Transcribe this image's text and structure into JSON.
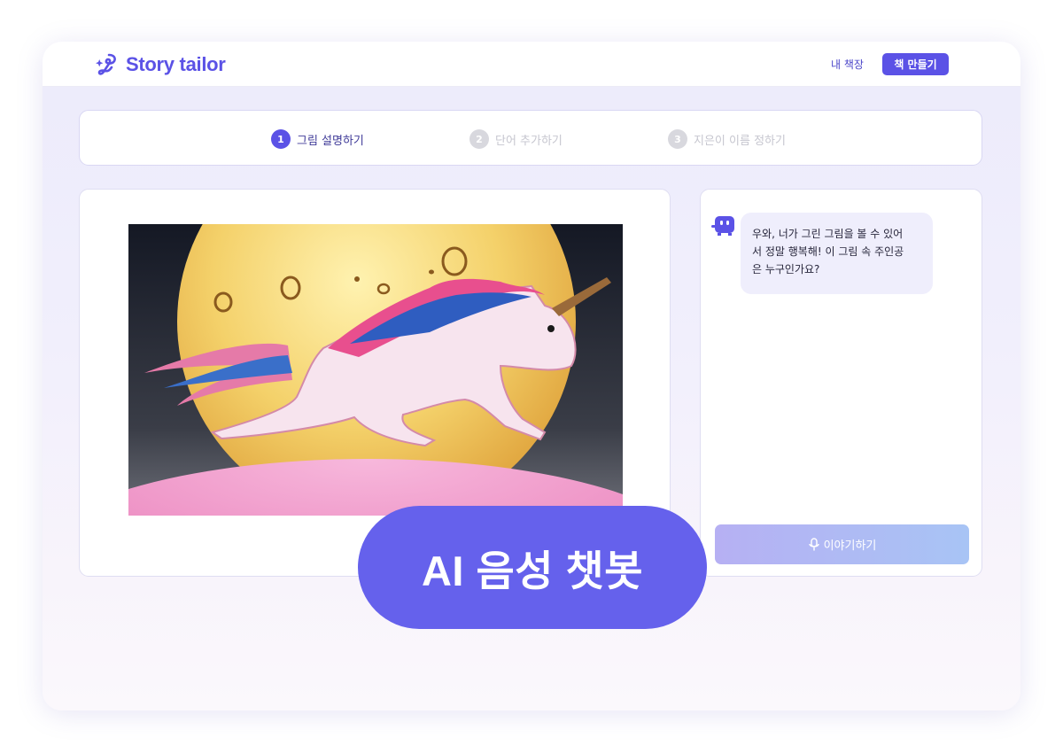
{
  "header": {
    "logo_text": "Story tailor",
    "nav_link": "내 책장",
    "nav_button": "책 만들기"
  },
  "steps": [
    {
      "number": "1",
      "label": "그림 설명하기",
      "state": "active"
    },
    {
      "number": "2",
      "label": "단어 추가하기",
      "state": "inactive"
    },
    {
      "number": "3",
      "label": "지은이 이름 정하기",
      "state": "inactive"
    }
  ],
  "chat": {
    "message": "우와, 너가 그린 그림을 볼 수 있어\n서 정말 행복해! 이 그림 속 주인공\n은 누구인가요?",
    "talk_button": "이야기하기"
  },
  "overlay": {
    "text": "AI 음성 챗봇"
  },
  "icons": {
    "logo": "sparkle-logo-icon",
    "bot": "robot-avatar-icon",
    "mic": "microphone-icon"
  },
  "colors": {
    "brand": "#5b52e6",
    "overlay": "#6561ec",
    "bubble": "#efeefc"
  }
}
